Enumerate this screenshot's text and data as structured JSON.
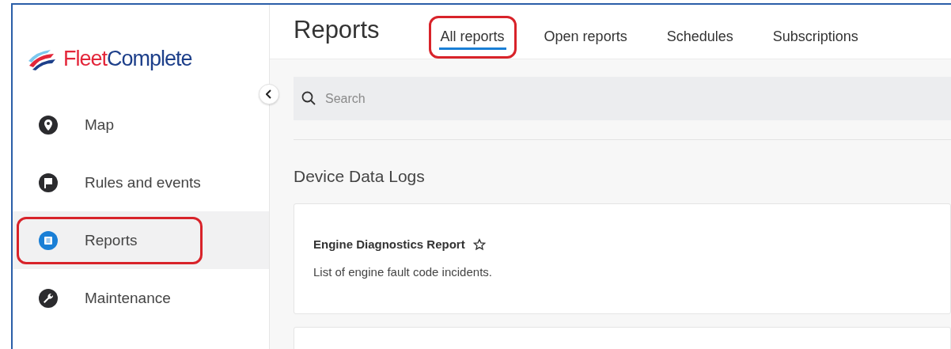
{
  "logo": {
    "word_1": "Fleet",
    "word_2": "Complete"
  },
  "sidebar": {
    "items": [
      {
        "label": "Map",
        "kind": "pin",
        "selected": false,
        "highlighted": false
      },
      {
        "label": "Rules and events",
        "kind": "flag",
        "selected": false,
        "highlighted": false
      },
      {
        "label": "Reports",
        "kind": "report",
        "selected": true,
        "highlighted": true
      },
      {
        "label": "Maintenance",
        "kind": "wrench",
        "selected": false,
        "highlighted": false
      }
    ]
  },
  "header": {
    "title": "Reports",
    "tabs": [
      {
        "label": "All reports",
        "selected": true,
        "highlighted": true
      },
      {
        "label": "Open reports",
        "selected": false,
        "highlighted": false
      },
      {
        "label": "Schedules",
        "selected": false,
        "highlighted": false
      },
      {
        "label": "Subscriptions",
        "selected": false,
        "highlighted": false
      }
    ]
  },
  "search": {
    "placeholder": "Search"
  },
  "section": {
    "title": "Device Data Logs",
    "reports": [
      {
        "title": "Engine Diagnostics Report",
        "favorite": false,
        "description": "List of engine fault code incidents."
      }
    ]
  }
}
